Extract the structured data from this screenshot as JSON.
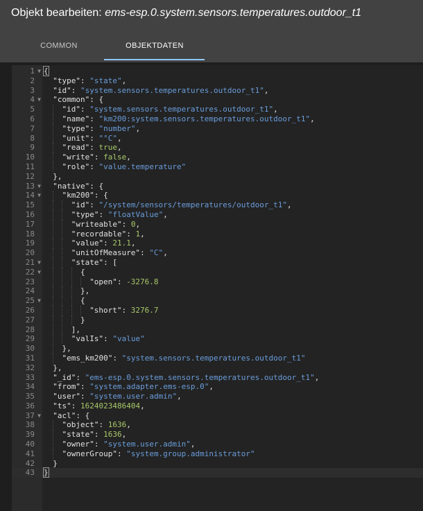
{
  "dialog": {
    "title_prefix": "Objekt bearbeiten: ",
    "object_id": "ems-esp.0.system.sensors.temperatures.outdoor_t1"
  },
  "tabs": [
    {
      "label": "COMMON",
      "active": false
    },
    {
      "label": "OBJEKTDATEN",
      "active": true
    }
  ],
  "colors": {
    "string": "#6a9ddb",
    "number": "#a8c96a",
    "tab_indicator": "#90caf9"
  },
  "editor": {
    "lines": [
      {
        "n": "1",
        "fold": true,
        "indent": 0,
        "tokens": [
          {
            "t": "punct",
            "v": "{",
            "cursor": true
          }
        ]
      },
      {
        "n": "2",
        "indent": 1,
        "tokens": [
          {
            "t": "key",
            "v": "\"type\""
          },
          {
            "t": "punct",
            "v": ": "
          },
          {
            "t": "str",
            "v": "\"state\""
          },
          {
            "t": "punct",
            "v": ","
          }
        ]
      },
      {
        "n": "3",
        "indent": 1,
        "tokens": [
          {
            "t": "key",
            "v": "\"id\""
          },
          {
            "t": "punct",
            "v": ": "
          },
          {
            "t": "str",
            "v": "\"system.sensors.temperatures.outdoor_t1\""
          },
          {
            "t": "punct",
            "v": ","
          }
        ]
      },
      {
        "n": "4",
        "fold": true,
        "indent": 1,
        "tokens": [
          {
            "t": "key",
            "v": "\"common\""
          },
          {
            "t": "punct",
            "v": ": {"
          }
        ]
      },
      {
        "n": "5",
        "indent": 2,
        "tokens": [
          {
            "t": "key",
            "v": "\"id\""
          },
          {
            "t": "punct",
            "v": ": "
          },
          {
            "t": "str",
            "v": "\"system.sensors.temperatures.outdoor_t1\""
          },
          {
            "t": "punct",
            "v": ","
          }
        ]
      },
      {
        "n": "6",
        "indent": 2,
        "tokens": [
          {
            "t": "key",
            "v": "\"name\""
          },
          {
            "t": "punct",
            "v": ": "
          },
          {
            "t": "str",
            "v": "\"km200:system.sensors.temperatures.outdoor_t1\""
          },
          {
            "t": "punct",
            "v": ","
          }
        ]
      },
      {
        "n": "7",
        "indent": 2,
        "tokens": [
          {
            "t": "key",
            "v": "\"type\""
          },
          {
            "t": "punct",
            "v": ": "
          },
          {
            "t": "str",
            "v": "\"number\""
          },
          {
            "t": "punct",
            "v": ","
          }
        ]
      },
      {
        "n": "8",
        "indent": 2,
        "tokens": [
          {
            "t": "key",
            "v": "\"unit\""
          },
          {
            "t": "punct",
            "v": ": "
          },
          {
            "t": "str",
            "v": "\"°C\""
          },
          {
            "t": "punct",
            "v": ","
          }
        ]
      },
      {
        "n": "9",
        "indent": 2,
        "tokens": [
          {
            "t": "key",
            "v": "\"read\""
          },
          {
            "t": "punct",
            "v": ": "
          },
          {
            "t": "bool",
            "v": "true"
          },
          {
            "t": "punct",
            "v": ","
          }
        ]
      },
      {
        "n": "10",
        "indent": 2,
        "tokens": [
          {
            "t": "key",
            "v": "\"write\""
          },
          {
            "t": "punct",
            "v": ": "
          },
          {
            "t": "bool",
            "v": "false"
          },
          {
            "t": "punct",
            "v": ","
          }
        ]
      },
      {
        "n": "11",
        "indent": 2,
        "tokens": [
          {
            "t": "key",
            "v": "\"role\""
          },
          {
            "t": "punct",
            "v": ": "
          },
          {
            "t": "str",
            "v": "\"value.temperature\""
          }
        ]
      },
      {
        "n": "12",
        "indent": 1,
        "tokens": [
          {
            "t": "punct",
            "v": "},"
          }
        ]
      },
      {
        "n": "13",
        "fold": true,
        "indent": 1,
        "tokens": [
          {
            "t": "key",
            "v": "\"native\""
          },
          {
            "t": "punct",
            "v": ": {"
          }
        ]
      },
      {
        "n": "14",
        "fold": true,
        "indent": 2,
        "tokens": [
          {
            "t": "key",
            "v": "\"km200\""
          },
          {
            "t": "punct",
            "v": ": {"
          }
        ]
      },
      {
        "n": "15",
        "indent": 3,
        "tokens": [
          {
            "t": "key",
            "v": "\"id\""
          },
          {
            "t": "punct",
            "v": ": "
          },
          {
            "t": "str",
            "v": "\"/system/sensors/temperatures/outdoor_t1\""
          },
          {
            "t": "punct",
            "v": ","
          }
        ]
      },
      {
        "n": "16",
        "indent": 3,
        "tokens": [
          {
            "t": "key",
            "v": "\"type\""
          },
          {
            "t": "punct",
            "v": ": "
          },
          {
            "t": "str",
            "v": "\"floatValue\""
          },
          {
            "t": "punct",
            "v": ","
          }
        ]
      },
      {
        "n": "17",
        "indent": 3,
        "tokens": [
          {
            "t": "key",
            "v": "\"writeable\""
          },
          {
            "t": "punct",
            "v": ": "
          },
          {
            "t": "num",
            "v": "0"
          },
          {
            "t": "punct",
            "v": ","
          }
        ]
      },
      {
        "n": "18",
        "indent": 3,
        "tokens": [
          {
            "t": "key",
            "v": "\"recordable\""
          },
          {
            "t": "punct",
            "v": ": "
          },
          {
            "t": "num",
            "v": "1"
          },
          {
            "t": "punct",
            "v": ","
          }
        ]
      },
      {
        "n": "19",
        "indent": 3,
        "tokens": [
          {
            "t": "key",
            "v": "\"value\""
          },
          {
            "t": "punct",
            "v": ": "
          },
          {
            "t": "num",
            "v": "21.1"
          },
          {
            "t": "punct",
            "v": ","
          }
        ]
      },
      {
        "n": "20",
        "indent": 3,
        "tokens": [
          {
            "t": "key",
            "v": "\"unitOfMeasure\""
          },
          {
            "t": "punct",
            "v": ": "
          },
          {
            "t": "str",
            "v": "\"C\""
          },
          {
            "t": "punct",
            "v": ","
          }
        ]
      },
      {
        "n": "21",
        "fold": true,
        "indent": 3,
        "tokens": [
          {
            "t": "key",
            "v": "\"state\""
          },
          {
            "t": "punct",
            "v": ": ["
          }
        ]
      },
      {
        "n": "22",
        "fold": true,
        "indent": 4,
        "tokens": [
          {
            "t": "punct",
            "v": "{"
          }
        ]
      },
      {
        "n": "23",
        "indent": 5,
        "tokens": [
          {
            "t": "key",
            "v": "\"open\""
          },
          {
            "t": "punct",
            "v": ": "
          },
          {
            "t": "num",
            "v": "-3276.8"
          }
        ]
      },
      {
        "n": "24",
        "indent": 4,
        "tokens": [
          {
            "t": "punct",
            "v": "},"
          }
        ]
      },
      {
        "n": "25",
        "fold": true,
        "indent": 4,
        "tokens": [
          {
            "t": "punct",
            "v": "{"
          }
        ]
      },
      {
        "n": "26",
        "indent": 5,
        "tokens": [
          {
            "t": "key",
            "v": "\"short\""
          },
          {
            "t": "punct",
            "v": ": "
          },
          {
            "t": "num",
            "v": "3276.7"
          }
        ]
      },
      {
        "n": "27",
        "indent": 4,
        "tokens": [
          {
            "t": "punct",
            "v": "}"
          }
        ]
      },
      {
        "n": "28",
        "indent": 3,
        "tokens": [
          {
            "t": "punct",
            "v": "],"
          }
        ]
      },
      {
        "n": "29",
        "indent": 3,
        "tokens": [
          {
            "t": "key",
            "v": "\"valIs\""
          },
          {
            "t": "punct",
            "v": ": "
          },
          {
            "t": "str",
            "v": "\"value\""
          }
        ]
      },
      {
        "n": "30",
        "indent": 2,
        "tokens": [
          {
            "t": "punct",
            "v": "},"
          }
        ]
      },
      {
        "n": "31",
        "indent": 2,
        "tokens": [
          {
            "t": "key",
            "v": "\"ems_km200\""
          },
          {
            "t": "punct",
            "v": ": "
          },
          {
            "t": "str",
            "v": "\"system.sensors.temperatures.outdoor_t1\""
          }
        ]
      },
      {
        "n": "32",
        "indent": 1,
        "tokens": [
          {
            "t": "punct",
            "v": "},"
          }
        ]
      },
      {
        "n": "33",
        "indent": 1,
        "tokens": [
          {
            "t": "key",
            "v": "\"_id\""
          },
          {
            "t": "punct",
            "v": ": "
          },
          {
            "t": "str",
            "v": "\"ems-esp.0.system.sensors.temperatures.outdoor_t1\""
          },
          {
            "t": "punct",
            "v": ","
          }
        ]
      },
      {
        "n": "34",
        "indent": 1,
        "tokens": [
          {
            "t": "key",
            "v": "\"from\""
          },
          {
            "t": "punct",
            "v": ": "
          },
          {
            "t": "str",
            "v": "\"system.adapter.ems-esp.0\""
          },
          {
            "t": "punct",
            "v": ","
          }
        ]
      },
      {
        "n": "35",
        "indent": 1,
        "tokens": [
          {
            "t": "key",
            "v": "\"user\""
          },
          {
            "t": "punct",
            "v": ": "
          },
          {
            "t": "str",
            "v": "\"system.user.admin\""
          },
          {
            "t": "punct",
            "v": ","
          }
        ]
      },
      {
        "n": "36",
        "indent": 1,
        "tokens": [
          {
            "t": "key",
            "v": "\"ts\""
          },
          {
            "t": "punct",
            "v": ": "
          },
          {
            "t": "num",
            "v": "1624023486404"
          },
          {
            "t": "punct",
            "v": ","
          }
        ]
      },
      {
        "n": "37",
        "fold": true,
        "indent": 1,
        "tokens": [
          {
            "t": "key",
            "v": "\"acl\""
          },
          {
            "t": "punct",
            "v": ": {"
          }
        ]
      },
      {
        "n": "38",
        "indent": 2,
        "tokens": [
          {
            "t": "key",
            "v": "\"object\""
          },
          {
            "t": "punct",
            "v": ": "
          },
          {
            "t": "num",
            "v": "1636"
          },
          {
            "t": "punct",
            "v": ","
          }
        ]
      },
      {
        "n": "39",
        "indent": 2,
        "tokens": [
          {
            "t": "key",
            "v": "\"state\""
          },
          {
            "t": "punct",
            "v": ": "
          },
          {
            "t": "num",
            "v": "1636"
          },
          {
            "t": "punct",
            "v": ","
          }
        ]
      },
      {
        "n": "40",
        "indent": 2,
        "tokens": [
          {
            "t": "key",
            "v": "\"owner\""
          },
          {
            "t": "punct",
            "v": ": "
          },
          {
            "t": "str",
            "v": "\"system.user.admin\""
          },
          {
            "t": "punct",
            "v": ","
          }
        ]
      },
      {
        "n": "41",
        "indent": 2,
        "tokens": [
          {
            "t": "key",
            "v": "\"ownerGroup\""
          },
          {
            "t": "punct",
            "v": ": "
          },
          {
            "t": "str",
            "v": "\"system.group.administrator\""
          }
        ]
      },
      {
        "n": "42",
        "indent": 1,
        "tokens": [
          {
            "t": "punct",
            "v": "}"
          }
        ]
      },
      {
        "n": "43",
        "active": true,
        "indent": 0,
        "tokens": [
          {
            "t": "punct",
            "v": "}",
            "cursor": true
          }
        ]
      }
    ]
  }
}
